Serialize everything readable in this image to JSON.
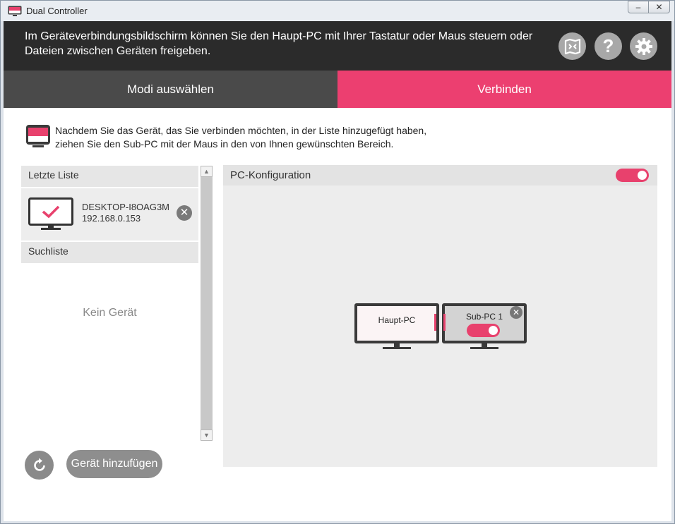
{
  "window": {
    "title": "Dual Controller",
    "minimize_label": "–",
    "close_label": "✕"
  },
  "header": {
    "text": "Im Geräteverbindungsbildschirm können Sie den Haupt-PC mit Ihrer Tastatur oder Maus steuern oder Dateien zwischen Geräten freigeben.",
    "icons": [
      "guide-icon",
      "help-icon",
      "settings-icon"
    ],
    "help_glyph": "?"
  },
  "tabs": [
    {
      "label": "Modi auswählen",
      "active": false
    },
    {
      "label": "Verbinden",
      "active": true
    }
  ],
  "instruction": {
    "line1": "Nachdem Sie das Gerät, das Sie verbinden möchten, in der Liste hinzugefügt haben,",
    "line2": "ziehen Sie den Sub-PC mit der Maus in den von Ihnen gewünschten Bereich."
  },
  "recent_list": {
    "heading": "Letzte Liste",
    "items": [
      {
        "name": "DESKTOP-I8OAG3M",
        "ip": "192.168.0.153",
        "remove_glyph": "✕"
      }
    ]
  },
  "search_list": {
    "heading": "Suchliste",
    "empty_text": "Kein Gerät"
  },
  "scrollbar": {
    "up_glyph": "▲",
    "down_glyph": "▼"
  },
  "buttons": {
    "add_device": "Gerät hinzufügen"
  },
  "pc_config": {
    "heading": "PC-Konfiguration",
    "toggle_on": true,
    "main_pc": {
      "label": "Haupt-PC"
    },
    "sub_pc": {
      "label": "Sub-PC 1",
      "toggle_on": true,
      "close_glyph": "✕"
    }
  },
  "colors": {
    "accent": "#ec3f70",
    "header_bg": "#2b2b2b",
    "tab_inactive": "#4a4a4a",
    "icon_gray": "#a8a8a8"
  }
}
